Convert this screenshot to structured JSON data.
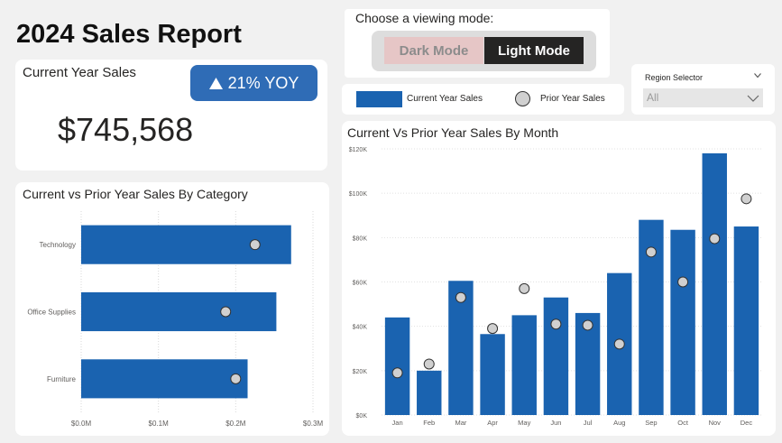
{
  "report": {
    "title": "2024 Sales Report"
  },
  "kpi": {
    "label": "Current Year Sales",
    "value": "$745,568",
    "badge_icon": "triangle-up-icon",
    "badge_text": "21% YOY"
  },
  "mode": {
    "prompt": "Choose a viewing mode:",
    "dark_label": "Dark Mode",
    "light_label": "Light Mode",
    "selected": "Light Mode"
  },
  "region": {
    "label": "Region Selector",
    "value": "All"
  },
  "legend": {
    "current_label": "Current Year Sales",
    "prior_label": "Prior Year Sales"
  },
  "colors": {
    "current": "#1a63b0",
    "prior_fill": "#d0d0d0",
    "prior_stroke": "#333333",
    "badge": "#2f6cb6"
  },
  "category_chart": {
    "title": "Current vs Prior Year Sales By Category"
  },
  "month_chart": {
    "title": "Current Vs Prior Year Sales By Month"
  },
  "chart_data": [
    {
      "type": "bar",
      "orientation": "horizontal",
      "title": "Current vs Prior Year Sales By Category",
      "categories": [
        "Technology",
        "Office Supplies",
        "Furniture"
      ],
      "series": [
        {
          "name": "Current Year Sales",
          "values": [
            271730,
            252612,
            215387
          ]
        },
        {
          "name": "Prior Year Sales",
          "values": [
            225000,
            187000,
            200000
          ]
        }
      ],
      "xlim": [
        0,
        300000
      ],
      "xticks": [
        0,
        100000,
        200000,
        300000
      ],
      "xtick_labels": [
        "$0.0M",
        "$0.1M",
        "$0.2M",
        "$0.3M"
      ],
      "grid": true
    },
    {
      "type": "bar",
      "title": "Current Vs Prior Year Sales By Month",
      "categories": [
        "Jan",
        "Feb",
        "Mar",
        "Apr",
        "May",
        "Jun",
        "Jul",
        "Aug",
        "Sep",
        "Oct",
        "Nov",
        "Dec"
      ],
      "series": [
        {
          "name": "Current Year Sales",
          "values": [
            44000,
            20000,
            60500,
            36500,
            45000,
            53000,
            46000,
            64000,
            88000,
            83500,
            118000,
            85000
          ]
        },
        {
          "name": "Prior Year Sales",
          "values": [
            19000,
            23000,
            53000,
            39000,
            57000,
            41000,
            40500,
            32000,
            73500,
            60000,
            79500,
            97500
          ]
        }
      ],
      "ylim": [
        0,
        120000
      ],
      "yticks": [
        0,
        20000,
        40000,
        60000,
        80000,
        100000,
        120000
      ],
      "ytick_labels": [
        "$0K",
        "$20K",
        "$40K",
        "$60K",
        "$80K",
        "$100K",
        "$120K"
      ],
      "grid": true
    }
  ]
}
